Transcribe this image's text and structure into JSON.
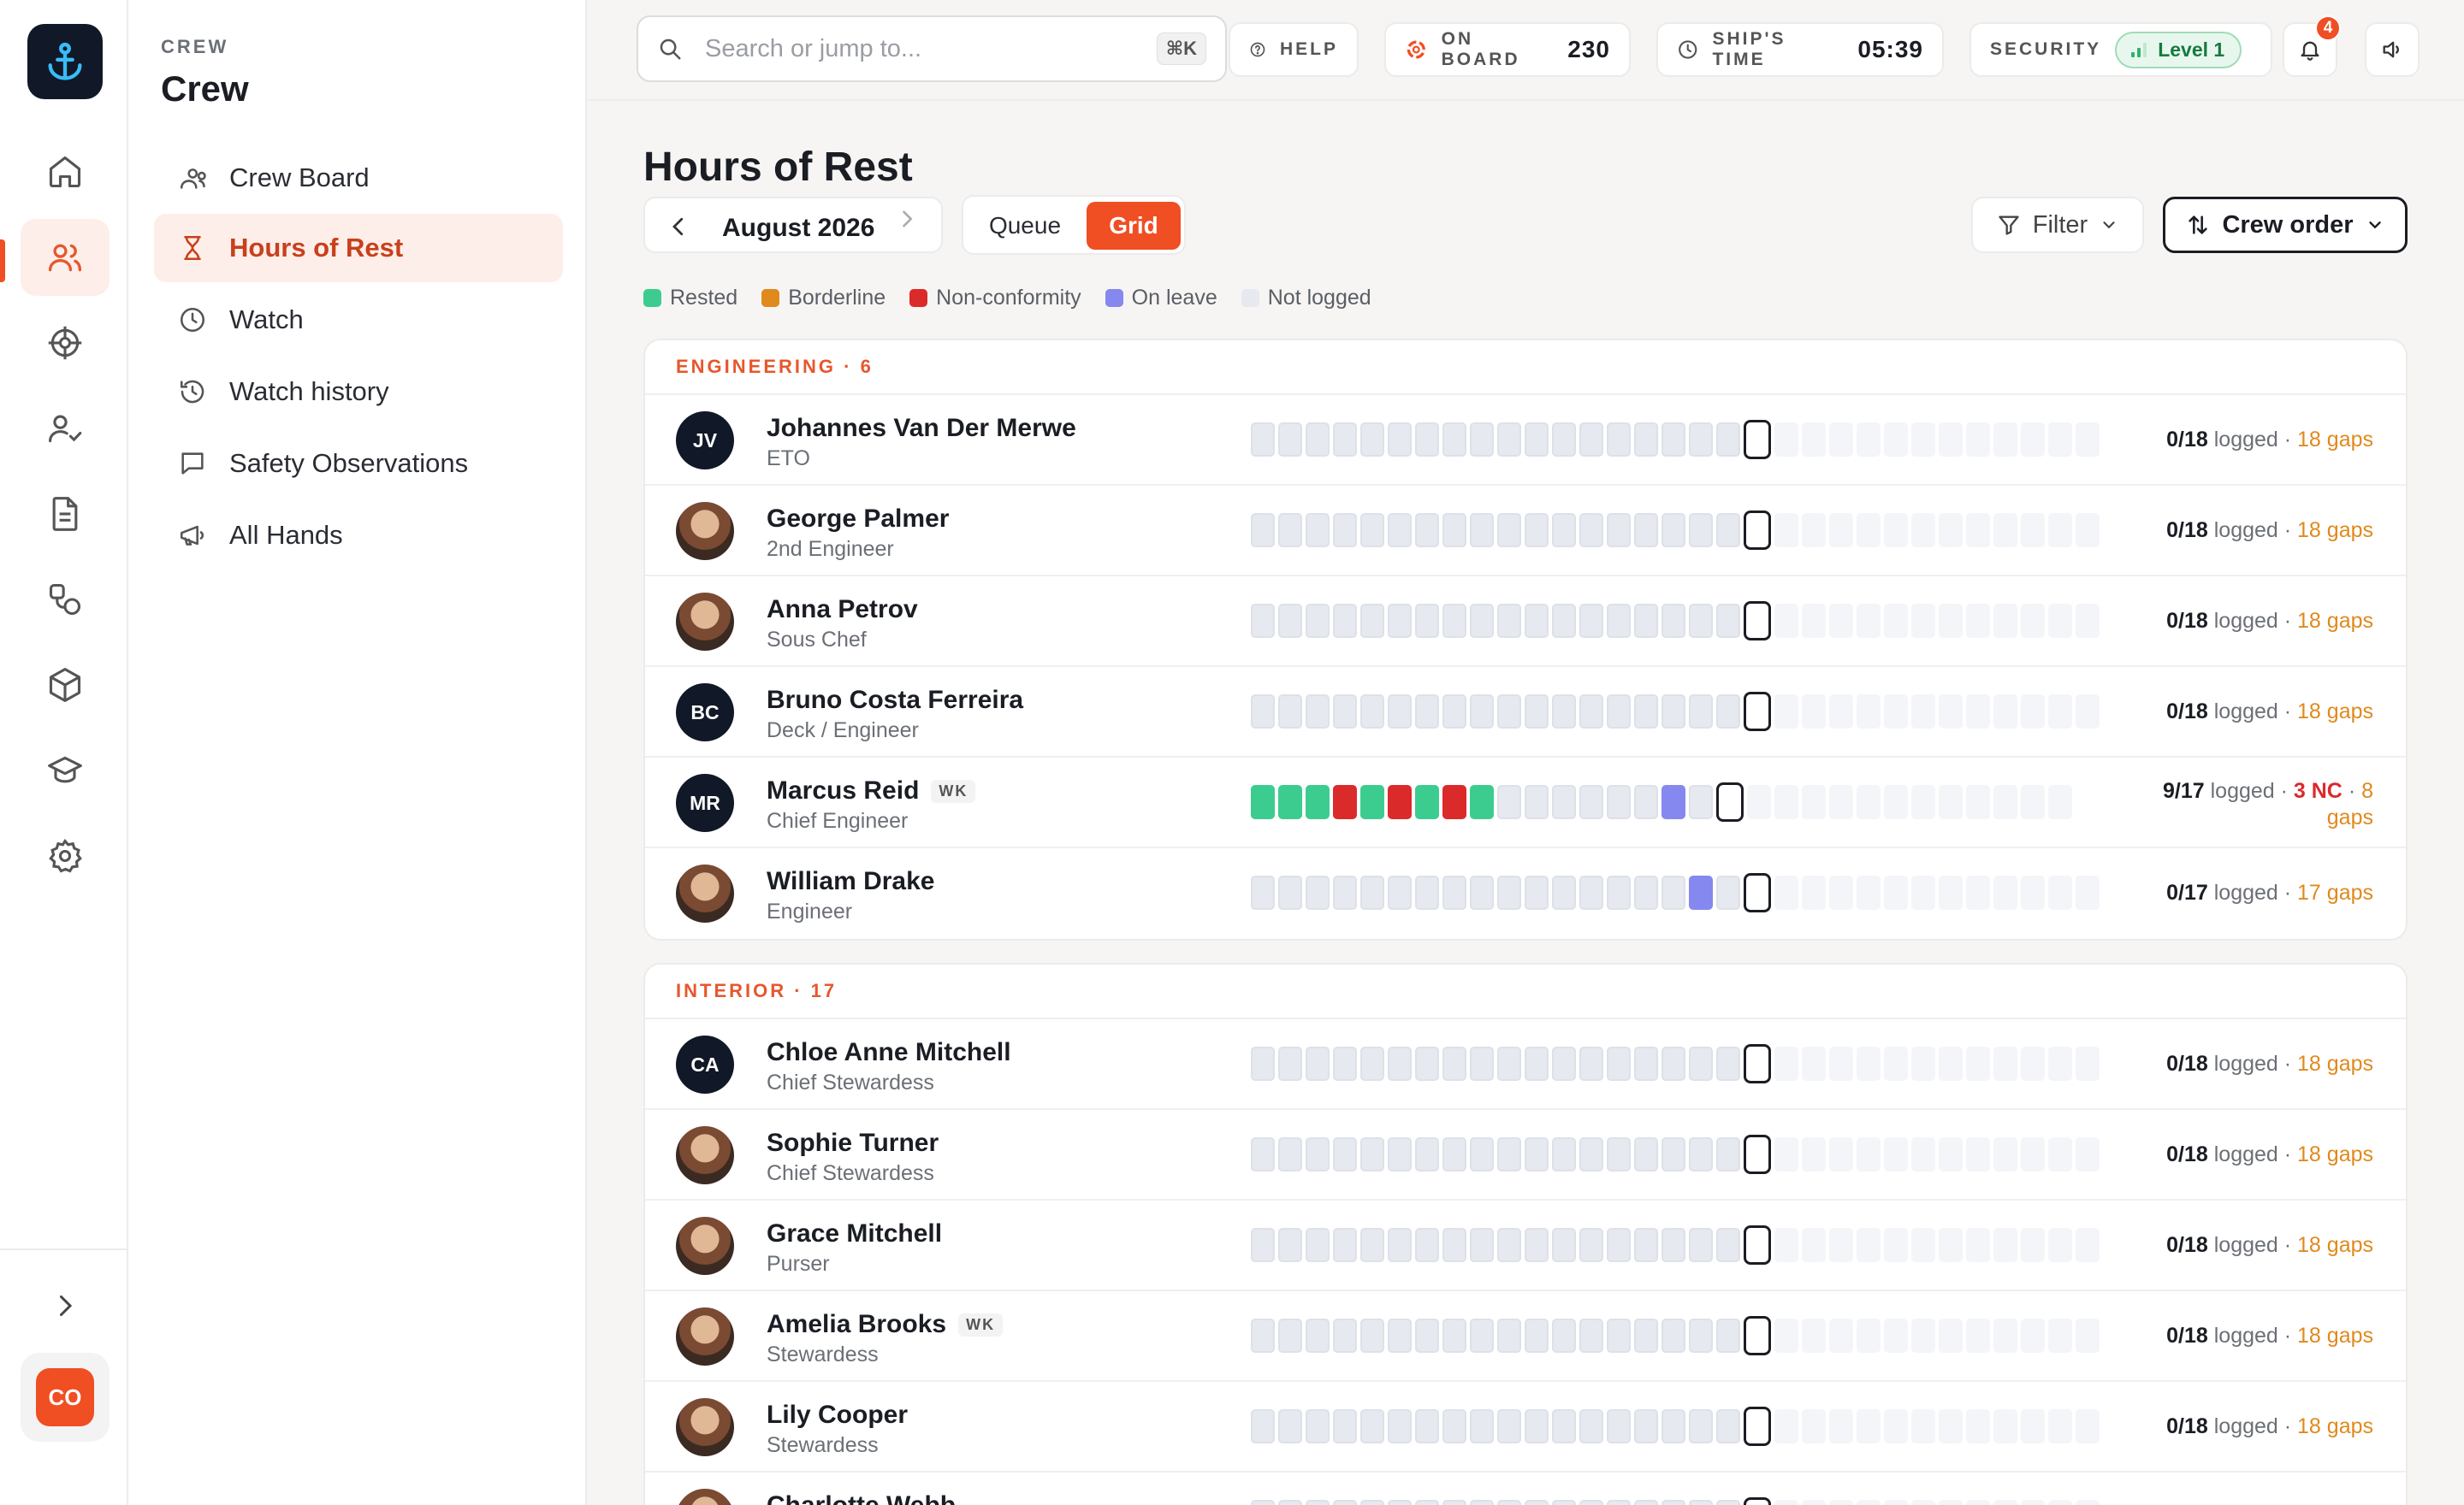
{
  "section": {
    "kicker": "CREW",
    "title": "Crew"
  },
  "nav": [
    {
      "label": "Crew Board",
      "icon": "people-icon",
      "active": false
    },
    {
      "label": "Hours of Rest",
      "icon": "hourglass-icon",
      "active": true
    },
    {
      "label": "Watch",
      "icon": "clock-icon",
      "active": false
    },
    {
      "label": "Watch history",
      "icon": "history-icon",
      "active": false
    },
    {
      "label": "Safety Observations",
      "icon": "message-icon",
      "active": false
    },
    {
      "label": "All Hands",
      "icon": "megaphone-icon",
      "active": false
    }
  ],
  "rail": {
    "items": [
      "home-icon",
      "crew-icon",
      "helm-icon",
      "user-check-icon",
      "document-icon",
      "shapes-icon",
      "cube-icon",
      "graduation-cap-icon",
      "settings-icon"
    ],
    "expand_icon": "chevron-right-icon",
    "user_initials": "CO"
  },
  "topbar": {
    "search_placeholder": "Search or jump to...",
    "search_shortcut": "⌘K",
    "help_label": "HELP",
    "onboard_label": "ON BOARD",
    "onboard_value": "230",
    "ships_time_label": "SHIP'S TIME",
    "ships_time_value": "05:39",
    "security_label": "SECURITY",
    "security_level": "Level 1",
    "notifications_count": "4"
  },
  "page": {
    "title": "Hours of Rest",
    "month": "August 2026",
    "view_queue": "Queue",
    "view_grid": "Grid",
    "filter_label": "Filter",
    "order_label": "Crew order"
  },
  "legend": [
    {
      "label": "Rested",
      "color": "#3dcc8f"
    },
    {
      "label": "Borderline",
      "color": "#e0891c"
    },
    {
      "label": "Non-conformity",
      "color": "#db2a2a"
    },
    {
      "label": "On leave",
      "color": "#8588ef"
    },
    {
      "label": "Not logged",
      "color": "#e6e9ef"
    }
  ],
  "groups": [
    {
      "header": "ENGINEERING · 6",
      "members": [
        {
          "initials": "JV",
          "photo": false,
          "name": "Johannes Van Der Merwe",
          "badge": "",
          "role": "ETO",
          "cells": "nnnnnnnnnnnnnnnnnnTffffffffffff",
          "logged": "0/18",
          "logged_word": "logged",
          "nc": "",
          "gaps": "18 gaps"
        },
        {
          "initials": "",
          "photo": true,
          "name": "George Palmer",
          "badge": "",
          "role": "2nd Engineer",
          "cells": "nnnnnnnnnnnnnnnnnnTffffffffffff",
          "logged": "0/18",
          "logged_word": "logged",
          "nc": "",
          "gaps": "18 gaps"
        },
        {
          "initials": "",
          "photo": true,
          "name": "Anna Petrov",
          "badge": "",
          "role": "Sous Chef",
          "cells": "nnnnnnnnnnnnnnnnnnTffffffffffff",
          "logged": "0/18",
          "logged_word": "logged",
          "nc": "",
          "gaps": "18 gaps"
        },
        {
          "initials": "BC",
          "photo": false,
          "name": "Bruno Costa Ferreira",
          "badge": "",
          "role": "Deck / Engineer",
          "cells": "nnnnnnnnnnnnnnnnnnTffffffffffff",
          "logged": "0/18",
          "logged_word": "logged",
          "nc": "",
          "gaps": "18 gaps"
        },
        {
          "initials": "MR",
          "photo": false,
          "name": "Marcus Reid",
          "badge": "WK",
          "role": "Chief Engineer",
          "cells": "rrrxrxrxrnnnnnnlnTffffffffffff",
          "logged": "9/17",
          "logged_word": "logged",
          "nc": "3 NC",
          "gaps": "8 gaps"
        },
        {
          "initials": "",
          "photo": true,
          "name": "William Drake",
          "badge": "",
          "role": "Engineer",
          "cells": "nnnnnnnnnnnnnnnnlnTffffffffffff",
          "logged": "0/17",
          "logged_word": "logged",
          "nc": "",
          "gaps": "17 gaps"
        }
      ]
    },
    {
      "header": "INTERIOR · 17",
      "members": [
        {
          "initials": "CA",
          "photo": false,
          "name": "Chloe Anne Mitchell",
          "badge": "",
          "role": "Chief Stewardess",
          "cells": "nnnnnnnnnnnnnnnnnnTffffffffffff",
          "logged": "0/18",
          "logged_word": "logged",
          "nc": "",
          "gaps": "18 gaps"
        },
        {
          "initials": "",
          "photo": true,
          "name": "Sophie Turner",
          "badge": "",
          "role": "Chief Stewardess",
          "cells": "nnnnnnnnnnnnnnnnnnTffffffffffff",
          "logged": "0/18",
          "logged_word": "logged",
          "nc": "",
          "gaps": "18 gaps"
        },
        {
          "initials": "",
          "photo": true,
          "name": "Grace Mitchell",
          "badge": "",
          "role": "Purser",
          "cells": "nnnnnnnnnnnnnnnnnnTffffffffffff",
          "logged": "0/18",
          "logged_word": "logged",
          "nc": "",
          "gaps": "18 gaps"
        },
        {
          "initials": "",
          "photo": true,
          "name": "Amelia Brooks",
          "badge": "WK",
          "role": "Stewardess",
          "cells": "nnnnnnnnnnnnnnnnnnTffffffffffff",
          "logged": "0/18",
          "logged_word": "logged",
          "nc": "",
          "gaps": "18 gaps"
        },
        {
          "initials": "",
          "photo": true,
          "name": "Lily Cooper",
          "badge": "",
          "role": "Stewardess",
          "cells": "nnnnnnnnnnnnnnnnnnTffffffffffff",
          "logged": "0/18",
          "logged_word": "logged",
          "nc": "",
          "gaps": "18 gaps"
        },
        {
          "initials": "",
          "photo": true,
          "name": "Charlotte Webb",
          "badge": "",
          "role": "",
          "cells": "nnnnnnnnnnnnnnnnnnTffffffffffff",
          "logged": "",
          "logged_word": "",
          "nc": "",
          "gaps": ""
        }
      ]
    }
  ]
}
